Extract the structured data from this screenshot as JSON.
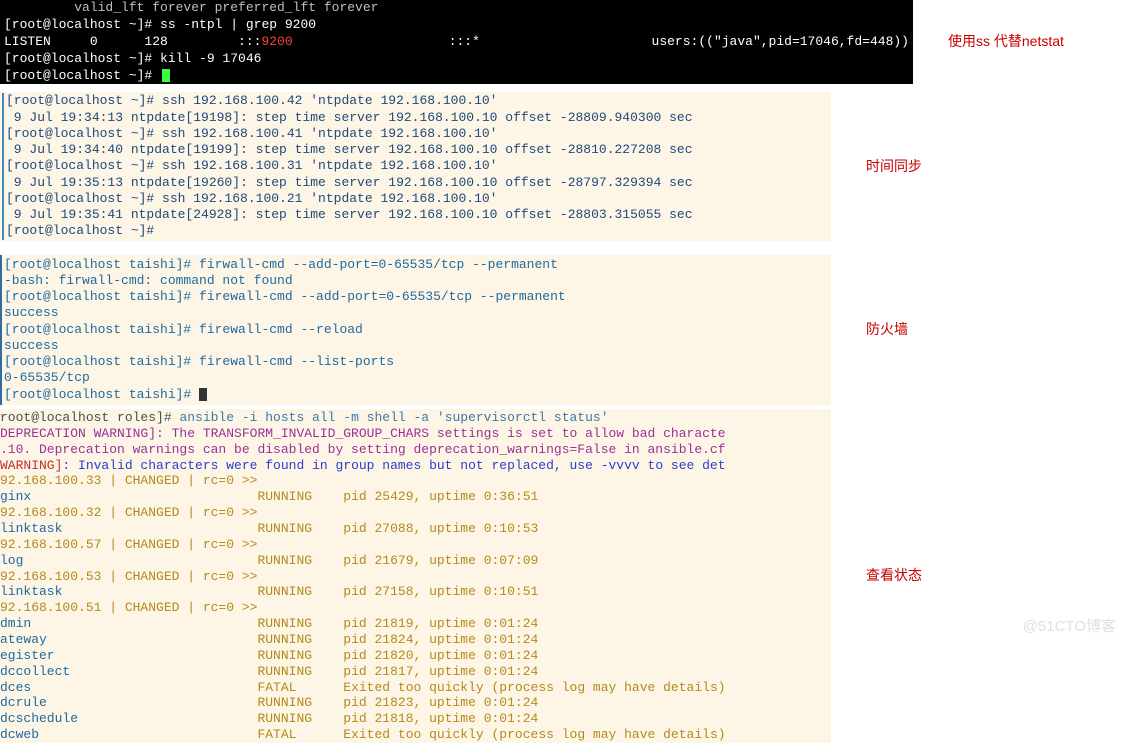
{
  "notes": {
    "ss": "使用ss 代替netstat",
    "ntp": "时间同步",
    "fw": "防火墙",
    "ansible": "查看状态"
  },
  "black_terminal": {
    "l1": "         valid_lft forever preferred_lft forever",
    "l2": "[root@localhost ~]# ss -ntpl | grep 9200",
    "l3a": "LISTEN     0      128         :::",
    "l3b": "9200",
    "l3c": "                    :::*                      users:((\"java\",pid=17046,fd=448))",
    "l4": "[root@localhost ~]# kill -9 17046",
    "l5": "[root@localhost ~]# "
  },
  "ntp": {
    "lines": [
      "[root@localhost ~]# ssh 192.168.100.42 'ntpdate 192.168.100.10'",
      " 9 Jul 19:34:13 ntpdate[19198]: step time server 192.168.100.10 offset -28809.940300 sec",
      "[root@localhost ~]# ssh 192.168.100.41 'ntpdate 192.168.100.10'",
      " 9 Jul 19:34:40 ntpdate[19199]: step time server 192.168.100.10 offset -28810.227208 sec",
      "[root@localhost ~]# ssh 192.168.100.31 'ntpdate 192.168.100.10'",
      " 9 Jul 19:35:13 ntpdate[19260]: step time server 192.168.100.10 offset -28797.329394 sec",
      "[root@localhost ~]# ssh 192.168.100.21 'ntpdate 192.168.100.10'",
      " 9 Jul 19:35:41 ntpdate[24928]: step time server 192.168.100.10 offset -28803.315055 sec",
      "[root@localhost ~]#"
    ]
  },
  "firewall": {
    "lines": [
      "[root@localhost taishi]# firwall-cmd --add-port=0-65535/tcp --permanent",
      "-bash: firwall-cmd: command not found",
      "[root@localhost taishi]# firewall-cmd --add-port=0-65535/tcp --permanent",
      "success",
      "[root@localhost taishi]# firewall-cmd --reload",
      "success",
      "[root@localhost taishi]# firewall-cmd --list-ports",
      "0-65535/tcp",
      "[root@localhost taishi]# "
    ]
  },
  "ansible": {
    "cmd_prompt": "root@localhost roles]# ",
    "cmd": "ansible -i hosts all -m shell -a 'supervisorctl status'",
    "dep1": "DEPRECATION WARNING]: The TRANSFORM_INVALID_GROUP_CHARS settings is set to allow bad characte",
    "dep2": ".10. Deprecation warnings can be disabled by setting deprecation_warnings=False in ansible.cf",
    "warn": "WARNING]: Invalid characters were found in group names but not replaced, use -vvvv to see det",
    "hosts": [
      {
        "host": "92.168.100.33 | CHANGED | rc=0 >>",
        "rows": [
          {
            "n": "ginx",
            "s": "RUNNING",
            "d": "pid 25429, uptime 0:36:51"
          }
        ]
      },
      {
        "host": "92.168.100.32 | CHANGED | rc=0 >>",
        "rows": [
          {
            "n": "linktask",
            "s": "RUNNING",
            "d": "pid 27088, uptime 0:10:53"
          }
        ]
      },
      {
        "host": "92.168.100.57 | CHANGED | rc=0 >>",
        "rows": [
          {
            "n": "log",
            "s": "RUNNING",
            "d": "pid 21679, uptime 0:07:09"
          }
        ]
      },
      {
        "host": "92.168.100.53 | CHANGED | rc=0 >>",
        "rows": [
          {
            "n": "linktask",
            "s": "RUNNING",
            "d": "pid 27158, uptime 0:10:51"
          }
        ]
      },
      {
        "host": "92.168.100.51 | CHANGED | rc=0 >>",
        "rows": [
          {
            "n": "dmin",
            "s": "RUNNING",
            "d": "pid 21819, uptime 0:01:24"
          },
          {
            "n": "ateway",
            "s": "RUNNING",
            "d": "pid 21824, uptime 0:01:24"
          },
          {
            "n": "egister",
            "s": "RUNNING",
            "d": "pid 21820, uptime 0:01:24"
          },
          {
            "n": "dccollect",
            "s": "RUNNING",
            "d": "pid 21817, uptime 0:01:24"
          },
          {
            "n": "dces",
            "s": "FATAL",
            "d": "Exited too quickly (process log may have details)"
          },
          {
            "n": "dcrule",
            "s": "RUNNING",
            "d": "pid 21823, uptime 0:01:24"
          },
          {
            "n": "dcschedule",
            "s": "RUNNING",
            "d": "pid 21818, uptime 0:01:24"
          },
          {
            "n": "dcweb",
            "s": "FATAL",
            "d": "Exited too quickly (process log may have details)"
          }
        ]
      }
    ]
  },
  "watermark": "@51CTO博客"
}
